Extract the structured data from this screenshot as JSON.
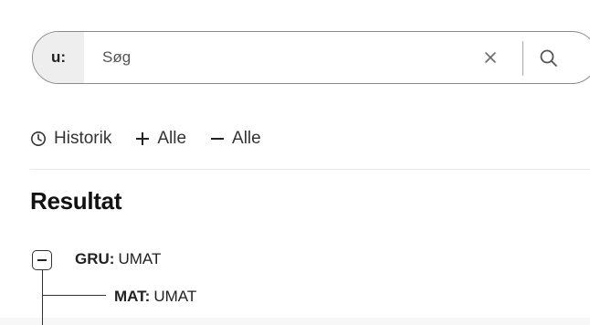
{
  "search": {
    "prefix": "u:",
    "placeholder": "Søg",
    "value": ""
  },
  "toolbar": {
    "history_label": "Historik",
    "expand_all_label": "Alle",
    "collapse_all_label": "Alle"
  },
  "results": {
    "title": "Resultat",
    "tree": [
      {
        "key": "GRU:",
        "value": "UMAT"
      },
      {
        "key": "MAT:",
        "value": "UMAT"
      }
    ]
  },
  "icons": {
    "clear": "close-icon",
    "search": "search-icon",
    "history": "clock-icon",
    "expand": "plus-icon",
    "collapse": "minus-icon",
    "tree_toggle": "minus-box-icon"
  },
  "colors": {
    "text": "#222222",
    "border": "#8a8a8a",
    "prefix_bg": "#eeeeee"
  }
}
